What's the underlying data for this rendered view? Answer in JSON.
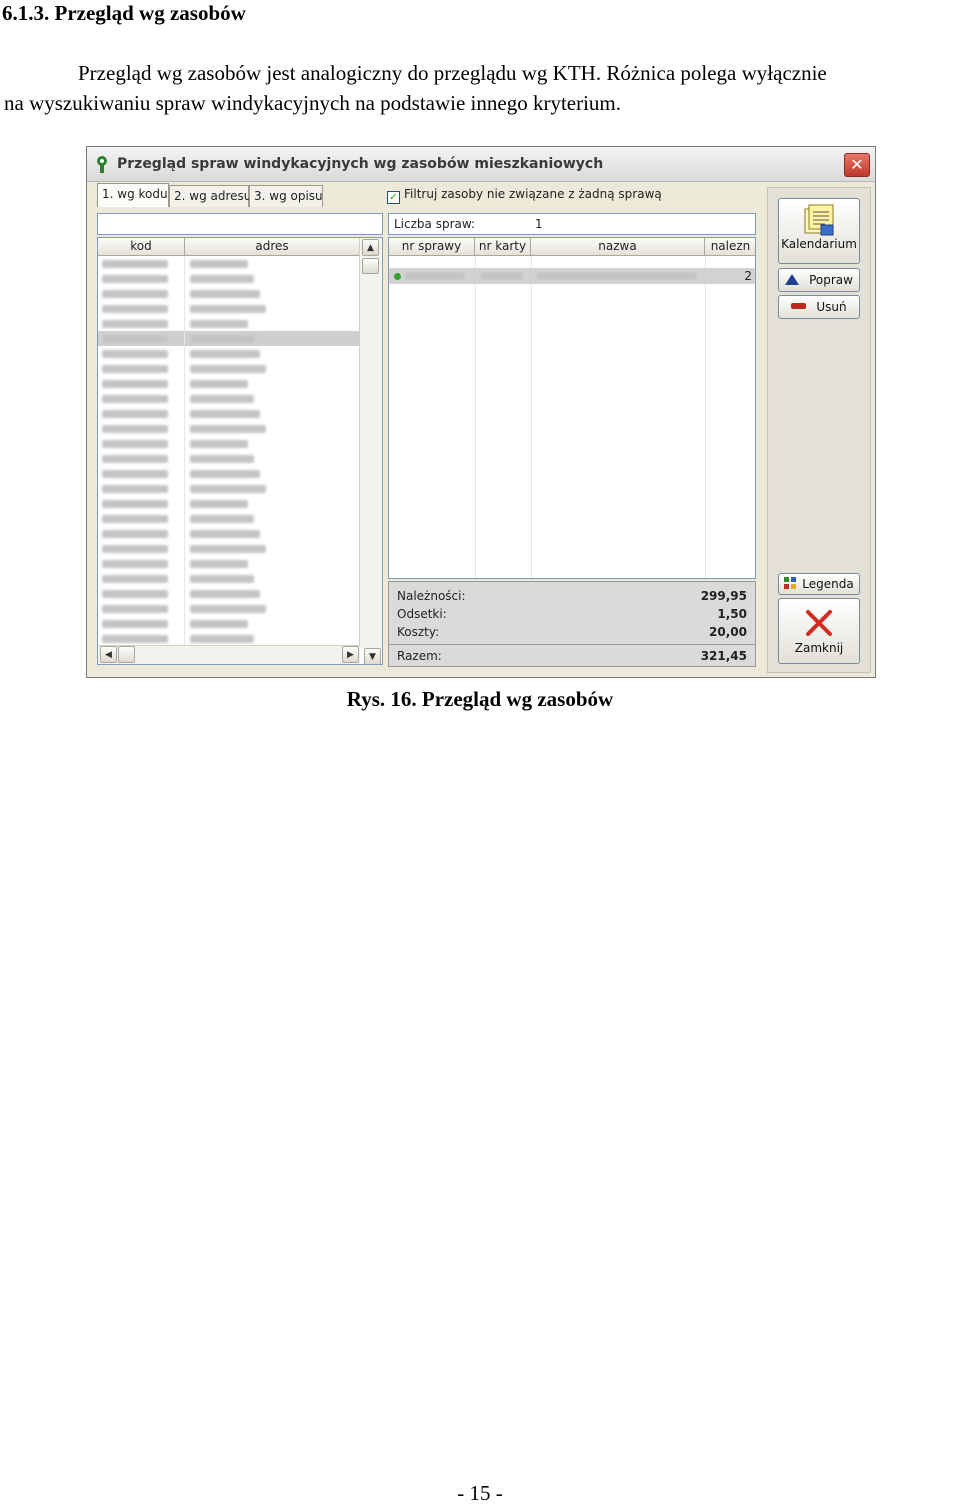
{
  "document": {
    "heading": "6.1.3. Przegląd wg zasobów",
    "paragraph_line1": "Przegląd wg zasobów jest analogiczny do przeglądu wg KTH. Różnica polega wyłącznie",
    "paragraph_line2": "na wyszukiwaniu spraw windykacyjnych na podstawie innego kryterium.",
    "caption": "Rys. 16. Przegląd wg zasobów",
    "page_number": "- 15 -"
  },
  "window": {
    "title": "Przegląd spraw windykacyjnych wg zasobów mieszkaniowych",
    "close_symbol": "✕",
    "tabs": [
      {
        "label": "1. wg kodu",
        "active": true
      },
      {
        "label": "2. wg adresu",
        "active": false
      },
      {
        "label": "3. wg opisu",
        "active": false
      }
    ],
    "filter_checkbox": {
      "label": "Filtruj zasoby nie związane z żadną sprawą",
      "checked": true,
      "check_mark": "✓"
    },
    "left_grid": {
      "columns": [
        "kod",
        "adres"
      ]
    },
    "info": {
      "label": "Liczba spraw:",
      "value": "1"
    },
    "right_grid": {
      "columns": [
        "nr sprawy",
        "nr karty",
        "nazwa",
        "nalezn"
      ],
      "row_end_value": "2"
    },
    "summary": [
      {
        "label": "Należności:",
        "value": "299,95"
      },
      {
        "label": "Odsetki:",
        "value": "1,50"
      },
      {
        "label": "Koszty:",
        "value": "20,00"
      },
      {
        "label": "Razem:",
        "value": "321,45"
      }
    ],
    "buttons": {
      "kalendarium": "Kalendarium",
      "popraw": "Popraw",
      "usun": "Usuń",
      "legenda": "Legenda",
      "zamknij": "Zamknij"
    },
    "scroll_arrows": {
      "up": "▲",
      "down": "▼",
      "left": "◀",
      "right": "▶"
    }
  }
}
